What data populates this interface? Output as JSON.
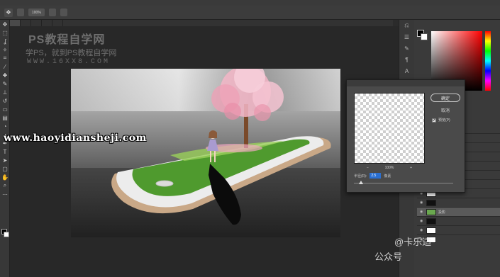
{
  "menu": {
    "items": [
      "",
      "",
      "",
      "",
      "",
      "",
      "",
      "",
      "",
      "",
      ""
    ]
  },
  "options": {
    "tool_icon": "move-tool",
    "items": [
      "",
      "100%",
      "",
      ""
    ]
  },
  "tabs": [
    "",
    "",
    "",
    "",
    ""
  ],
  "watermarks": {
    "line1": "PS教程自学网",
    "line2": "学PS，就到PS教程自学网",
    "line3": "WWW.16XX8.COM",
    "url": "www.haoyidiansheji.com",
    "corner1": "@卡乐适",
    "corner2": "公众号"
  },
  "dialog": {
    "title": "",
    "ok_label": "确定",
    "cancel_label": "取消",
    "preview_label": "预览(P)",
    "preview_checked": "✔",
    "zoom_out": "−",
    "zoom_level": "100%",
    "zoom_in": "+",
    "radius_label": "半径(R):",
    "radius_value": "2.5",
    "radius_unit": "像素",
    "radius_level": 0.07
  },
  "colors": {
    "accent": "#2a6fd1",
    "foreground": "#000000",
    "background": "#ffffff"
  },
  "layers": [
    {
      "label": ""
    },
    {
      "label": ""
    },
    {
      "label": ""
    },
    {
      "label": ""
    },
    {
      "label": ""
    },
    {
      "label": ""
    },
    {
      "label": ""
    },
    {
      "label": ""
    },
    {
      "label": "投影"
    },
    {
      "label": ""
    },
    {
      "label": ""
    },
    {
      "label": ""
    }
  ]
}
